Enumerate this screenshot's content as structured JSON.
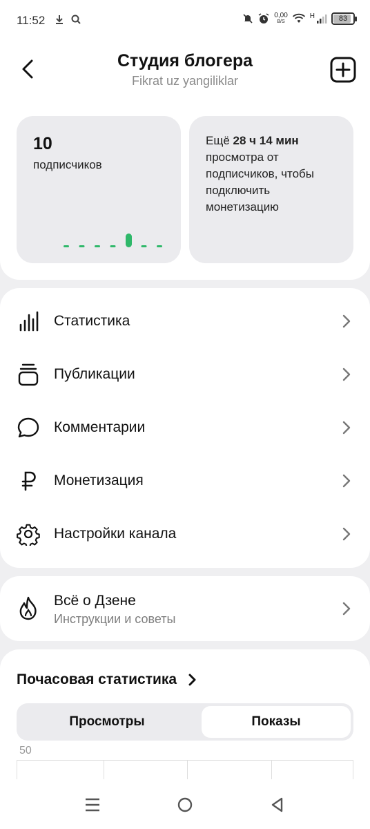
{
  "status_bar": {
    "time": "11:52",
    "net_speed_value": "0,00",
    "net_speed_unit": "B/S",
    "signal_label": "H",
    "battery_percent": "83"
  },
  "header": {
    "title": "Студия блогера",
    "subtitle": "Fikrat uz yangiliklar"
  },
  "subscribers_card": {
    "count": "10",
    "label": "подписчиков",
    "mini_chart": [
      0,
      0,
      0,
      0,
      1,
      0,
      0
    ],
    "accent_color": "#2fb86a"
  },
  "monetization_card": {
    "prefix": "Ещё ",
    "remaining": "28 ч 14 мин",
    "suffix": " просмотра от подписчиков, чтобы подключить монетизацию"
  },
  "menu": {
    "items": [
      {
        "label": "Статистика",
        "icon": "bar-chart-icon"
      },
      {
        "label": "Публикации",
        "icon": "publications-icon"
      },
      {
        "label": "Комментарии",
        "icon": "comment-icon"
      },
      {
        "label": "Монетизация",
        "icon": "ruble-icon"
      },
      {
        "label": "Настройки канала",
        "icon": "gear-icon"
      }
    ]
  },
  "zen_info": {
    "title": "Всё о Дзене",
    "subtitle": "Инструкции и советы",
    "icon": "flame-icon"
  },
  "hourly_stats": {
    "title": "Почасовая статистика",
    "tabs": [
      "Просмотры",
      "Показы"
    ],
    "selected_tab": "Показы",
    "y_axis_max": "50"
  },
  "nav_bar": {
    "buttons": [
      "menu-icon",
      "home-icon",
      "back-icon"
    ]
  }
}
